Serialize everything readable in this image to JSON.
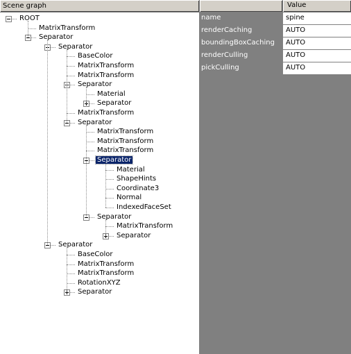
{
  "scene_graph_header": "Scene graph",
  "value_header": "Value",
  "tree": [
    {
      "label": "ROOT"
    },
    {
      "label": "MatrixTransform"
    },
    {
      "label": "Separator"
    },
    {
      "label": "Separator"
    },
    {
      "label": "BaseColor"
    },
    {
      "label": "MatrixTransform"
    },
    {
      "label": "MatrixTransform"
    },
    {
      "label": "Separator"
    },
    {
      "label": "Material"
    },
    {
      "label": "Separator"
    },
    {
      "label": "MatrixTransform"
    },
    {
      "label": "Separator"
    },
    {
      "label": "MatrixTransform"
    },
    {
      "label": "MatrixTransform"
    },
    {
      "label": "MatrixTransform"
    },
    {
      "label": "Separator"
    },
    {
      "label": "Material"
    },
    {
      "label": "ShapeHints"
    },
    {
      "label": "Coordinate3"
    },
    {
      "label": "Normal"
    },
    {
      "label": "IndexedFaceSet"
    },
    {
      "label": "Separator"
    },
    {
      "label": "MatrixTransform"
    },
    {
      "label": "Separator"
    },
    {
      "label": "Separator"
    },
    {
      "label": "BaseColor"
    },
    {
      "label": "MatrixTransform"
    },
    {
      "label": "MatrixTransform"
    },
    {
      "label": "RotationXYZ"
    },
    {
      "label": "Separator"
    }
  ],
  "properties": [
    {
      "name": "name",
      "value": "spine"
    },
    {
      "name": "renderCaching",
      "value": "AUTO"
    },
    {
      "name": "boundingBoxCaching",
      "value": "AUTO"
    },
    {
      "name": "renderCulling",
      "value": "AUTO"
    },
    {
      "name": "pickCulling",
      "value": "AUTO"
    }
  ]
}
